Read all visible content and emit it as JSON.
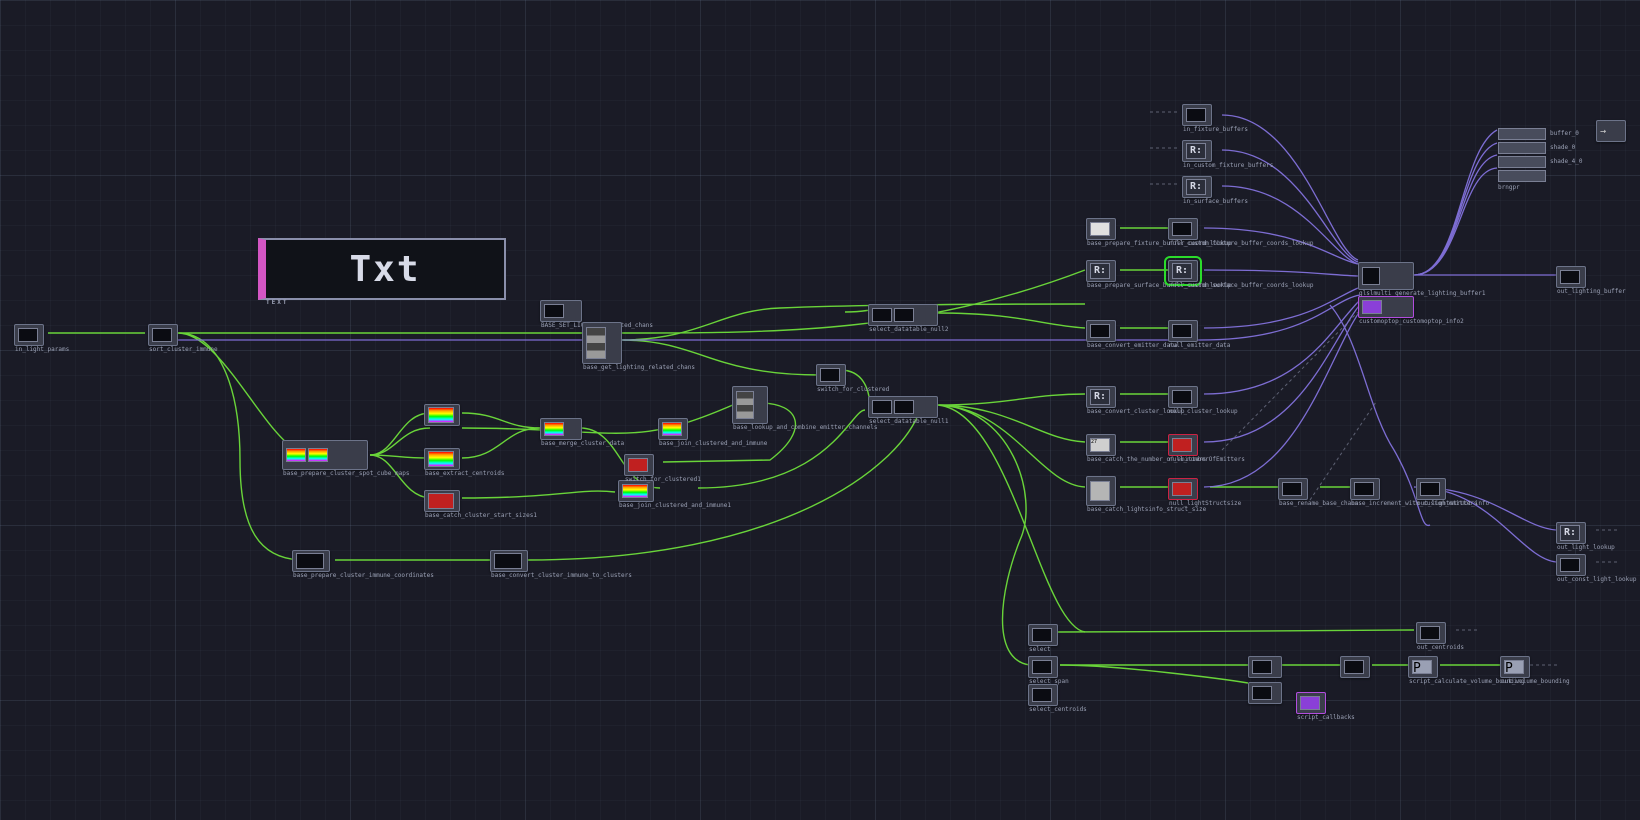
{
  "panel": {
    "title": "Txt",
    "title_small": "TEXT"
  },
  "inputs": {
    "in_light_params": "in_light_params",
    "sort_cluster_immune": "sort_cluster_immune"
  },
  "nodes": {
    "base_prepare_cluster_spot_cube_maps": "base_prepare_cluster_spot_cube_maps",
    "base_set_lighting_related_chans": "BASE_SET_LIGHTING_related_chans",
    "base_merge_cluster_data": "base_merge_cluster_data",
    "base_extract_centroids": "base_extract_centroids",
    "base_catch_cluster_start_sizes": "base_catch_cluster_start_sizes1",
    "base_get_lighting_related_chans": "base_get_lighting_related_chans",
    "base_lookup_and_combine_emitter_channels": "base_lookup_and_combine_emitter_channels",
    "switch_for_clustered": "switch_for_clustered",
    "switch_for_clustered1": "switch_for_clustered1",
    "base_join_clustered_and_immune": "base_join_clustered_and_immune",
    "base_join_clustered_and_immune1": "base_join_clustered_and_immune1",
    "select_centroids": "select_centroids",
    "select_span": "select_span",
    "select_t": "select",
    "select_datatable_null1": "select_datatable_null1",
    "select_datatable_null2": "select_datatable_null2",
    "base_prepare_fixture_buffer_coord_lookup": "base_prepare_fixture_buffer_coord_lookup",
    "base_prepare_surface_buffer_coord_lookup": "base_prepare_surface_buffer_coord_lookup",
    "base_convert_emitter_data": "base_convert_emitter_data",
    "base_convert_cluster_lookup": "base_convert_cluster_lookup",
    "base_catch_the_number_of_emitters": "base_catch_the_number_of_emitters",
    "base_catch_lightsinfo_struct_size": "base_catch_lightsinfo_struct_size",
    "null_custom_fixture_buffer_coords_lookup": "null_custom_fixture_buffer_coords_lookup",
    "null_custom_surface_buffer_coords_lookup": "null_custom_surface_buffer_coords_lookup",
    "null_emitter_data": "null_emitter_data",
    "null_cluster_lookup": "null_cluster_lookup",
    "null_number_of_emitters": "null_numberOfEmitters",
    "null_light_struct_size": "null_lightStructsize",
    "base_rename_base_chans": "base_rename_base_chans",
    "base_increment_with_custom_emitters": "base_increment_with_custom_emitters",
    "base_prepare_cluster_immune_coordinates": "base_prepare_cluster_immune_coordinates",
    "base_convert_cluster_immune_to_clusters": "base_convert_cluster_immune_to_clusters",
    "in_fixture_buffers": "in_fixture_buffers",
    "in_custom_fixture_buffers": "in_custom_fixture_buffers",
    "in_surface_buffers": "in_surface_buffers",
    "r1": "R:",
    "generate_lighting_buffer1": "glslmulti_generate_lighting_buffer1",
    "out_lighting_buffer": "out_lighting_buffer",
    "customoptop_customoptop_info2": "customoptop_customoptop_info2",
    "script_calculate_volume_bounding": "script_calculate_volume_bounding",
    "script_callbacks": "script_callbacks",
    "out_lightstruct_info": "out_lightstruct_info",
    "out_light_lookup": "out_light_lookup",
    "out_const_light_lookup": "out_const_light_lookup",
    "out_centroids": "out_centroids",
    "out_volume_bounding": "out_volume_bounding"
  },
  "outputs_big": {
    "buffer_0": "buffer_0",
    "shade_0": "shade_0",
    "shade_4_0": "shade_4_0",
    "brngpr": "brngpr"
  }
}
